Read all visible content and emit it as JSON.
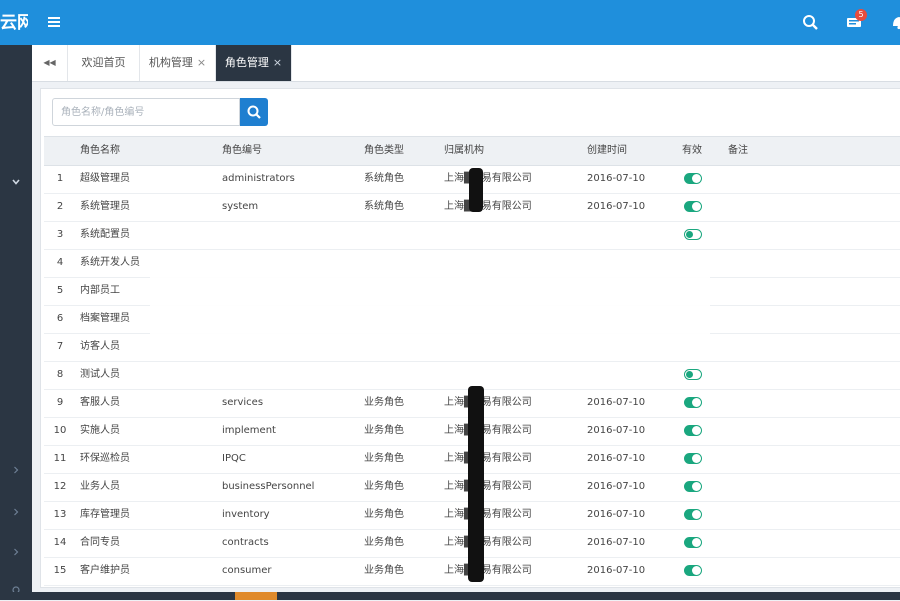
{
  "app": {
    "logo_text": "云网"
  },
  "icons": {
    "menu": "hamburger-icon",
    "search": "search-icon",
    "messages": "message-icon",
    "notifications": "bell-icon"
  },
  "header": {
    "message_count": "5"
  },
  "tabs": [
    {
      "label": "欢迎首页",
      "closable": false,
      "active": false
    },
    {
      "label": "机构管理",
      "closable": true,
      "active": false
    },
    {
      "label": "角色管理",
      "closable": true,
      "active": true
    }
  ],
  "tabs_close_glyph": "×",
  "tabs_back_glyph": "◀◀",
  "search": {
    "placeholder": "角色名称/角色编号",
    "value": ""
  },
  "table": {
    "columns": [
      "角色名称",
      "角色编号",
      "角色类型",
      "归属机构",
      "创建时间",
      "有效",
      "备注"
    ],
    "rows": [
      {
        "index": "1",
        "name": "超级管理员",
        "code": "administrators",
        "type": "系统角色",
        "org": "上海█贸易有限公司",
        "created": "2016-07-10",
        "active": true
      },
      {
        "index": "2",
        "name": "系统管理员",
        "code": "system",
        "type": "系统角色",
        "org": "上海█贸易有限公司",
        "created": "2016-07-10",
        "active": true
      },
      {
        "index": "3",
        "name": "系统配置员",
        "code": "",
        "type": "",
        "org": "",
        "created": "",
        "active": false
      },
      {
        "index": "4",
        "name": "系统开发人员",
        "code": "",
        "type": "",
        "org": "",
        "created": "",
        "active": null
      },
      {
        "index": "5",
        "name": "内部员工",
        "code": "",
        "type": "",
        "org": "",
        "created": "",
        "active": null
      },
      {
        "index": "6",
        "name": "档案管理员",
        "code": "",
        "type": "",
        "org": "",
        "created": "",
        "active": null
      },
      {
        "index": "7",
        "name": "访客人员",
        "code": "",
        "type": "",
        "org": "",
        "created": "",
        "active": null
      },
      {
        "index": "8",
        "name": "测试人员",
        "code": "",
        "type": "",
        "org": "",
        "created": "",
        "active": false
      },
      {
        "index": "9",
        "name": "客服人员",
        "code": "services",
        "type": "业务角色",
        "org": "上海█贸易有限公司",
        "created": "2016-07-10",
        "active": true
      },
      {
        "index": "10",
        "name": "实施人员",
        "code": "implement",
        "type": "业务角色",
        "org": "上海█贸易有限公司",
        "created": "2016-07-10",
        "active": true
      },
      {
        "index": "11",
        "name": "环保巡检员",
        "code": "IPQC",
        "type": "业务角色",
        "org": "上海█贸易有限公司",
        "created": "2016-07-10",
        "active": true
      },
      {
        "index": "12",
        "name": "业务人员",
        "code": "businessPersonnel",
        "type": "业务角色",
        "org": "上海█贸易有限公司",
        "created": "2016-07-10",
        "active": true
      },
      {
        "index": "13",
        "name": "库存管理员",
        "code": "inventory",
        "type": "业务角色",
        "org": "上海█贸易有限公司",
        "created": "2016-07-10",
        "active": true
      },
      {
        "index": "14",
        "name": "合同专员",
        "code": "contracts",
        "type": "业务角色",
        "org": "上海█贸易有限公司",
        "created": "2016-07-10",
        "active": true
      },
      {
        "index": "15",
        "name": "客户维护员",
        "code": "consumer",
        "type": "业务角色",
        "org": "上海█贸易有限公司",
        "created": "2016-07-10",
        "active": true
      }
    ]
  },
  "colors": {
    "topbar": "#1f8fdc",
    "sidebar": "#2b3643",
    "toggle_on": "#1aa77f",
    "search_button": "#1f7fd0",
    "badge": "#e74c3c"
  }
}
